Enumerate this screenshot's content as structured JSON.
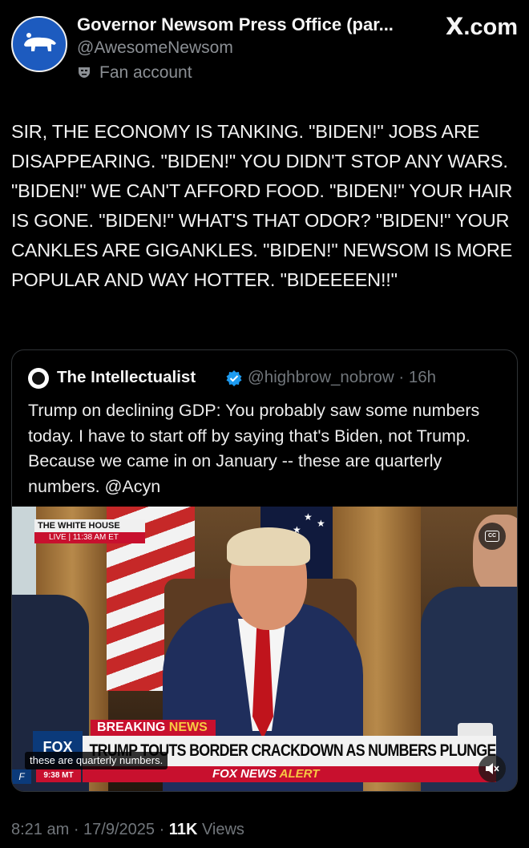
{
  "header": {
    "display_name": "Governor Newsom Press Office (par...",
    "handle": "@AwesomeNewsom",
    "fan_label": "Fan account",
    "site_x": "X",
    "site_com": ".com"
  },
  "post": {
    "text": "SIR, THE ECONOMY IS TANKING. \"BIDEN!\" JOBS ARE DISAPPEARING. \"BIDEN!\" YOU DIDN'T STOP ANY WARS. \"BIDEN!\" WE CAN'T AFFORD FOOD. \"BIDEN!\" YOUR HAIR IS GONE. \"BIDEN!\" WHAT'S THAT ODOR? \"BIDEN!\" YOUR CANKLES ARE GIGANKLES. \"BIDEN!\" NEWSOM IS MORE POPULAR AND WAY HOTTER. \"BIDEEEEN!!\""
  },
  "quote": {
    "name": "The Intellectualist",
    "handle_time": "@highbrow_nobrow · 16h",
    "text": "Trump on declining GDP: You probably saw some numbers today. I have to start off by saying that's Biden, not Trump. Because we came in on January -- these are quarterly numbers. @Acyn"
  },
  "video": {
    "network_label": "THE WHITE HOUSE",
    "live_label": "LIVE | 11:38 AM ET",
    "cc_label": "CC",
    "breaking_1": "BREAKING",
    "breaking_2": "NEWS",
    "headline": "TRUMP TOUTS BORDER CRACKDOWN AS NUMBERS PLUNGE",
    "fox_logo": "FOX",
    "alert_1": "FOX NEWS",
    "alert_2": "ALERT",
    "fnl": "F",
    "clock": "9:38 MT",
    "caption": "these are quarterly numbers."
  },
  "footer": {
    "time_date": "8:21 am · 17/9/2025 · ",
    "views_count": "11K",
    "views_label": " Views"
  },
  "colors": {
    "background": "#000000",
    "muted_text": "#71767b",
    "verified_blue": "#1d9bf0",
    "fox_red": "#c8102e"
  }
}
